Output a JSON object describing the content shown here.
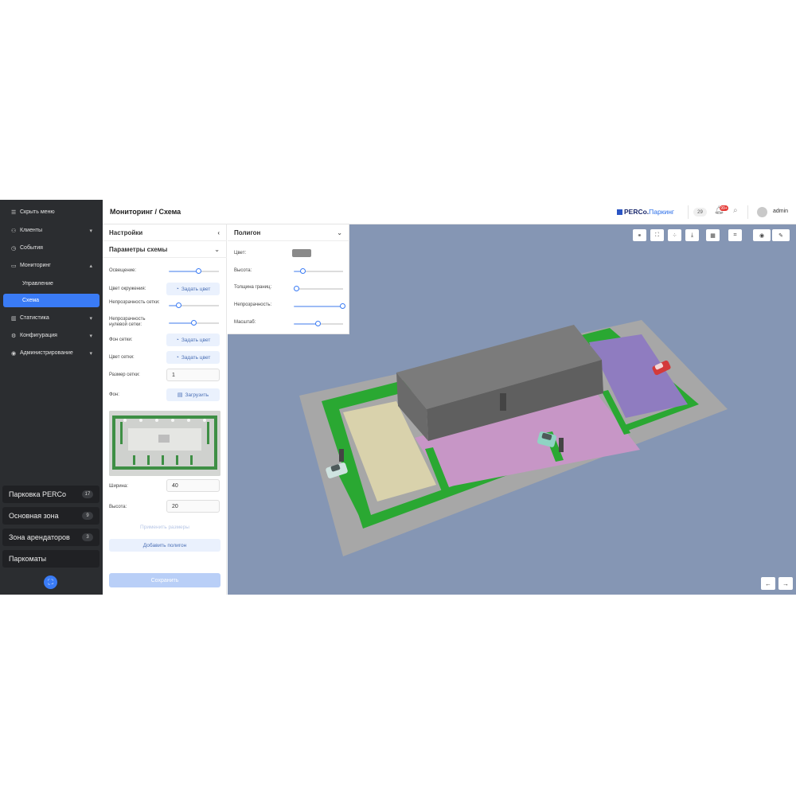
{
  "sidebar": {
    "items": [
      {
        "icon": "menu-icon",
        "glyph": "☰",
        "label": "Скрыть меню"
      },
      {
        "icon": "clients-icon",
        "glyph": "⚇",
        "label": "Клиенты"
      },
      {
        "icon": "events-icon",
        "glyph": "◷",
        "label": "События"
      },
      {
        "icon": "monitor-icon",
        "glyph": "▭",
        "label": "Мониторинг"
      },
      {
        "label": "Управление"
      },
      {
        "label": "Схема"
      },
      {
        "icon": "stats-icon",
        "glyph": "▥",
        "label": "Статистика"
      },
      {
        "icon": "config-icon",
        "glyph": "⚙",
        "label": "Конфигурация"
      },
      {
        "icon": "admin-icon",
        "glyph": "◉",
        "label": "Администрирование"
      }
    ],
    "zones": [
      {
        "label": "Парковка PERCo",
        "count": "17"
      },
      {
        "label": "Основная зона",
        "count": "9"
      },
      {
        "label": "Зона арендаторов",
        "count": "3"
      },
      {
        "label": "Паркоматы",
        "count": ""
      }
    ]
  },
  "header": {
    "breadcrumb": "Мониторинг / Схема",
    "brand_main": "PERCo.",
    "brand_suffix": "Паркинг",
    "count": "29",
    "notifications": "99+",
    "user": "admin"
  },
  "settings": {
    "title": "Настройки",
    "section": "Параметры схемы",
    "labels": {
      "lighting": "Освещение:",
      "env_color": "Цвет окружения:",
      "grid_opacity": "Непрозрачность сетки:",
      "zero_grid_opacity": "Непрозрачность нулевой сетки:",
      "grid_bg": "Фон сетки:",
      "grid_color": "Цвет сетки:",
      "grid_size": "Размер сетки:",
      "background": "Фон:",
      "width": "Ширина:",
      "height": "Высота:"
    },
    "values": {
      "lighting": 0.6,
      "grid_opacity": 0.2,
      "zero_grid_opacity": 0.5
    },
    "set_color_label": "Задать цвет",
    "upload_label": "Загрузить",
    "grid_size_value": "1",
    "width_value": "40",
    "height_value": "20",
    "apply_size_label": "Применить размеры",
    "add_polygon_label": "Добавить полигон",
    "save_label": "Сохранить"
  },
  "polygon": {
    "title": "Полигон",
    "labels": {
      "color": "Цвет:",
      "height": "Высота:",
      "border_width": "Толщина границ:",
      "opacity": "Непрозрачность:",
      "scale": "Масштаб:"
    },
    "values": {
      "height": 0.2,
      "border_width": 0.05,
      "opacity": 1.0,
      "scale": 0.5
    },
    "color": "#8a8a8a"
  },
  "viewport": {
    "toolbar": [
      "link-icon",
      "fullscreen-icon",
      "share-icon",
      "download-icon",
      "layout-icon",
      "focus-icon",
      "eye-icon",
      "pencil-icon"
    ],
    "background_color": "#8596b4"
  },
  "colors": {
    "accent": "#3a7bf5",
    "sidebar_bg": "#2b2d30",
    "green_border": "#2aa832",
    "purple_zone": "#8f7cc0",
    "pink_zone": "#c796c6",
    "beige_zone": "#d9d2ac",
    "building": "#6f6f6f"
  }
}
